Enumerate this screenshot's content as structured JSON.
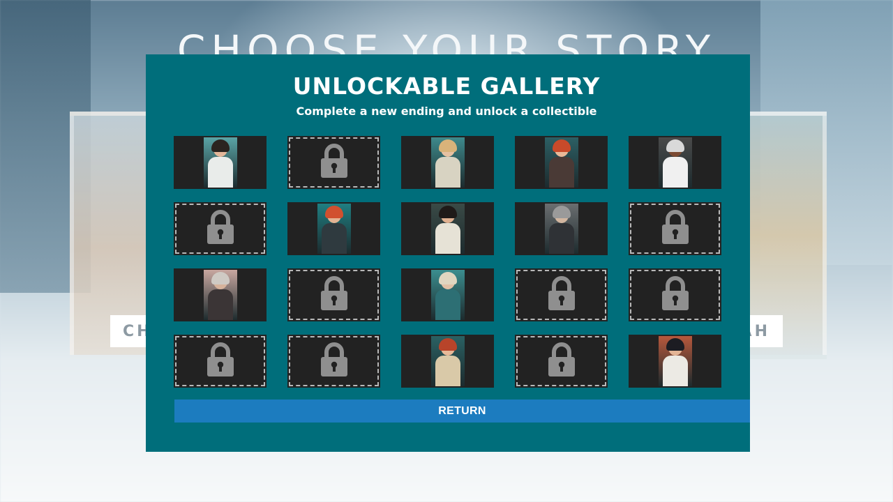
{
  "background": {
    "heading": "CHOOSE YOUR STORY",
    "left_card_label": "CH",
    "right_card_label": "AH"
  },
  "gallery": {
    "title": "UNLOCKABLE GALLERY",
    "subtitle": "Complete a new ending and unlock a collectible",
    "rows": 4,
    "columns": 5,
    "tiles": [
      {
        "state": "unlocked",
        "bg": "#5aa4a6",
        "hair": "#2b2420",
        "skin": "#e3b79a",
        "body": "#e9ecea"
      },
      {
        "state": "locked",
        "icon": "padlock-icon"
      },
      {
        "state": "unlocked",
        "bg": "#3e8a8c",
        "hair": "#d9b37a",
        "skin": "#e6c1a2",
        "body": "#d8d3c2"
      },
      {
        "state": "unlocked",
        "bg": "#2c5f64",
        "hair": "#c84a2a",
        "skin": "#e9b898",
        "body": "#4a3a36"
      },
      {
        "state": "unlocked",
        "bg": "#4a4a4a",
        "hair": "#d9d9d9",
        "skin": "#7b4a32",
        "body": "#f0f0f0"
      },
      {
        "state": "locked",
        "icon": "padlock-icon"
      },
      {
        "state": "unlocked",
        "bg": "#1f7f82",
        "hair": "#d1502f",
        "skin": "#e3b393",
        "body": "#2f3a3f"
      },
      {
        "state": "unlocked",
        "bg": "#3a4a46",
        "hair": "#1f1a18",
        "skin": "#e0b090",
        "body": "#e6e2d6"
      },
      {
        "state": "unlocked",
        "bg": "#6b6e70",
        "hair": "#9a9a9a",
        "skin": "#d2b6a0",
        "body": "#2f3236"
      },
      {
        "state": "locked",
        "icon": "padlock-icon"
      },
      {
        "state": "unlocked",
        "bg": "#c8a7a0",
        "hair": "#cfcac4",
        "skin": "#d7b39c",
        "body": "#3b3536"
      },
      {
        "state": "locked",
        "icon": "padlock-icon"
      },
      {
        "state": "unlocked",
        "bg": "#3b8e8f",
        "hair": "#e0d6c0",
        "skin": "#e1c1a6",
        "body": "#2d6f74"
      },
      {
        "state": "locked",
        "icon": "padlock-icon"
      },
      {
        "state": "locked",
        "icon": "padlock-icon"
      },
      {
        "state": "locked",
        "icon": "padlock-icon"
      },
      {
        "state": "locked",
        "icon": "padlock-icon"
      },
      {
        "state": "unlocked",
        "bg": "#2a6163",
        "hair": "#b8442a",
        "skin": "#e7b998",
        "body": "#d9c9a8"
      },
      {
        "state": "locked",
        "icon": "padlock-icon"
      },
      {
        "state": "unlocked",
        "bg": "#b7583c",
        "hair": "#1c1c22",
        "skin": "#e4b596",
        "body": "#eceae4"
      }
    ],
    "return_label": "RETURN"
  },
  "colors": {
    "modal_bg": "#006e7b",
    "tile_bg": "#222222",
    "lock_color": "#8f8f8f",
    "button_bg": "#1c7cbf"
  }
}
